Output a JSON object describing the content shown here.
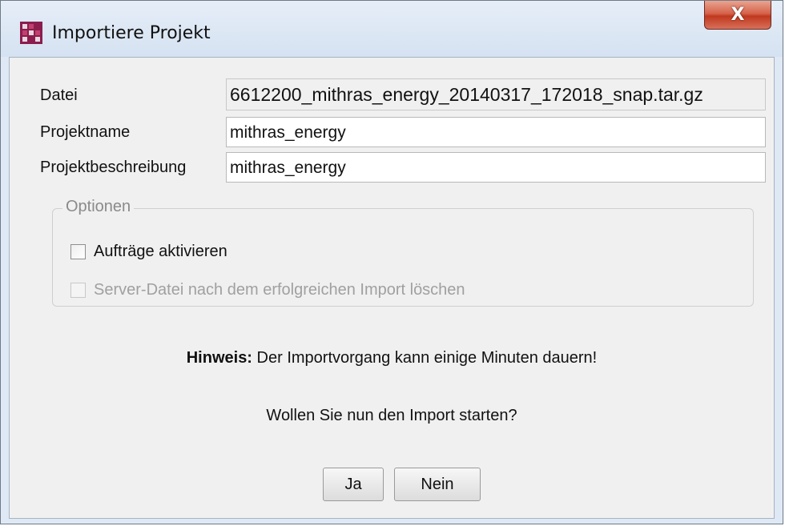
{
  "window": {
    "title": "Importiere Projekt",
    "close_label": "X",
    "icon": "app-logo-icon"
  },
  "form": {
    "file_label": "Datei",
    "file_value": "6612200_mithras_energy_20140317_172018_snap.tar.gz",
    "name_label": "Projektname",
    "name_value": "mithras_energy",
    "description_label": "Projektbeschreibung",
    "description_value": "mithras_energy"
  },
  "options": {
    "title": "Optionen",
    "activate_jobs_label": "Aufträge aktivieren",
    "activate_jobs_checked": false,
    "delete_server_file_label": "Server-Datei nach dem erfolgreichen Import löschen",
    "delete_server_file_checked": false,
    "delete_server_file_enabled": false
  },
  "messages": {
    "hint_bold": "Hinweis:",
    "hint_text": " Der Importvorgang kann einige Minuten dauern!",
    "question": "Wollen Sie nun den Import starten?"
  },
  "buttons": {
    "yes_label": "Ja",
    "no_label": "Nein"
  },
  "colors": {
    "close_button": "#c94a32",
    "title_bar": "#dce7f4",
    "dialog_background": "#f0f0f0",
    "disabled_text": "#a0a0a0"
  }
}
